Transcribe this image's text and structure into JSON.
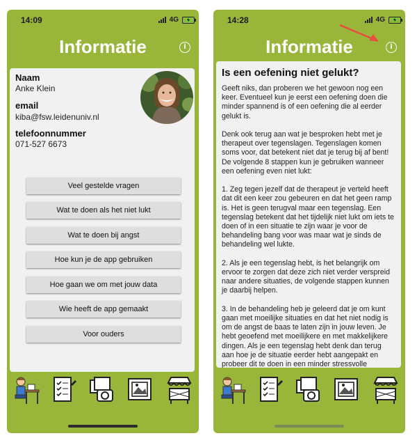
{
  "left": {
    "status": {
      "time": "14:09",
      "network": "4G"
    },
    "header": {
      "title": "Informatie",
      "info_icon_glyph": "i"
    },
    "contact": {
      "name_label": "Naam",
      "name": "Anke Klein",
      "email_label": "email",
      "email": "kiba@fsw.leidenuniv.nl",
      "phone_label": "telefoonnummer",
      "phone": "071-527 6673"
    },
    "menu": [
      {
        "label": "Veel gestelde vragen"
      },
      {
        "label": "Wat te doen als het niet lukt"
      },
      {
        "label": "Wat te doen bij angst"
      },
      {
        "label": "Hoe kun je de app gebruiken"
      },
      {
        "label": "Hoe gaan we om met jouw data"
      },
      {
        "label": "Wie heeft de app gemaakt"
      },
      {
        "label": "Voor ouders"
      }
    ]
  },
  "right": {
    "status": {
      "time": "14:28",
      "network": "4G"
    },
    "header": {
      "title": "Informatie",
      "info_icon_glyph": "i"
    },
    "article": {
      "heading": "Is een oefening niet gelukt?",
      "body": "Geeft niks, dan proberen we het gewoon nog een keer. Eventueel kun je eerst een oefening doen die minder spannend is of een oefening die al eerder gelukt is.\n\nDenk ook terug aan wat je besproken hebt met je therapeut over tegenslagen. Tegenslagen komen soms voor, dat betekent niet dat je terug bij af bent! De volgende 8 stappen kun je gebruiken wanneer een oefening even niet lukt:\n\n1. Zeg tegen jezelf dat de therapeut je verteld heeft dat dit een keer zou gebeuren en dat het geen ramp is. Het is geen terugval maar een tegenslag. Een tegenslag betekent dat het tijdelijk niet lukt om iets te doen of in een situatie te zijn waar je voor de behandeling bang voor was maar wat je sinds de behandeling wel lukte.\n\n2. Als je een tegenslag hebt, is het belangrijk om ervoor te zorgen dat deze zich niet verder verspreid naar andere situaties, de volgende stappen kunnen je daarbij helpen.\n\n3. In de behandeling heb je geleerd dat je om kunt gaan met moeilijke situaties en dat het niet nodig is om de angst de baas te laten zijn in jouw leven. Je hebt geoefend met moeilijkere en met makkelijkere dingen. Als je een tegenslag hebt denk dan terug aan hoe je de situatie eerder hebt aangepakt en probeer dit te doen in een minder stressvolle situatie. Was de oefening bijvoorbeeld minder"
    }
  },
  "nav_icons": [
    "person-at-desk-icon",
    "checklist-icon",
    "photos-camera-icon",
    "framed-picture-icon",
    "market-stall-icon"
  ],
  "colors": {
    "accent": "#9ab63a",
    "card": "#f1f1f1",
    "button": "#dedede",
    "arrow": "#e74c3c"
  }
}
